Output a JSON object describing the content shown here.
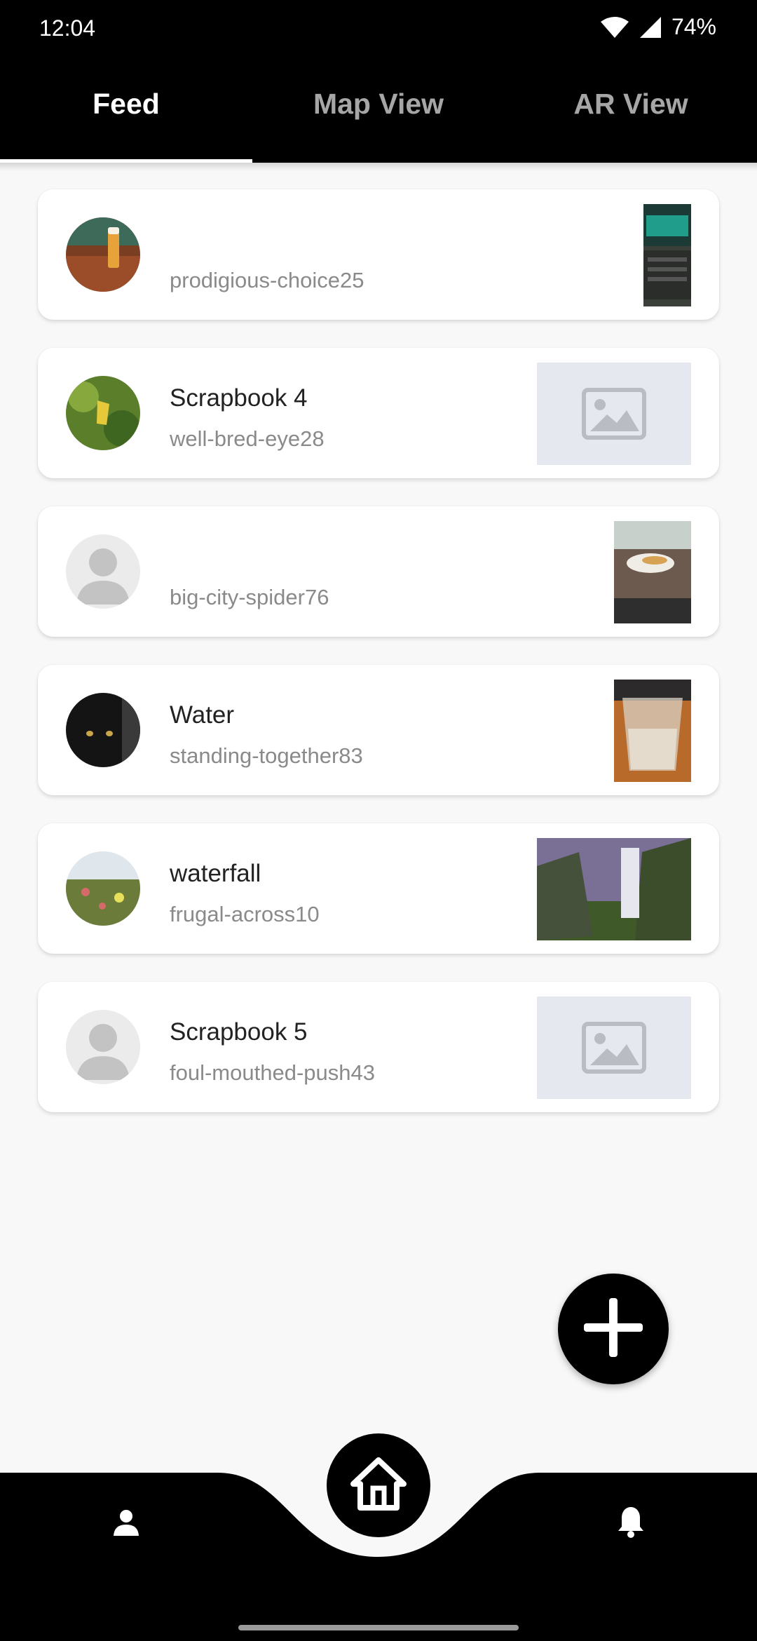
{
  "status_bar": {
    "time": "12:04",
    "battery": "74%"
  },
  "tabs": [
    {
      "label": "Feed",
      "active": true
    },
    {
      "label": "Map View",
      "active": false
    },
    {
      "label": "AR View",
      "active": false
    }
  ],
  "feed": [
    {
      "title": "",
      "user": "prodigious-choice25",
      "avatar": "beer-photo",
      "thumbnail": "laptop-photo"
    },
    {
      "title": "Scrapbook 4",
      "user": "well-bred-eye28",
      "avatar": "starfruit-photo",
      "thumbnail": "image-placeholder-icon"
    },
    {
      "title": "",
      "user": "big-city-spider76",
      "avatar": "default-person-icon",
      "thumbnail": "food-table-photo"
    },
    {
      "title": "Water",
      "user": "standing-together83",
      "avatar": "black-cat-photo",
      "thumbnail": "water-glass-photo"
    },
    {
      "title": "waterfall",
      "user": "frugal-across10",
      "avatar": "flower-field-photo",
      "thumbnail": "waterfall-photo"
    },
    {
      "title": "Scrapbook 5",
      "user": "foul-mouthed-push43",
      "avatar": "default-person-icon",
      "thumbnail": "image-placeholder-icon"
    }
  ],
  "icons": {
    "fab": "plus-icon",
    "nav_left": "person-icon",
    "nav_center": "home-icon",
    "nav_right": "bell-icon"
  },
  "colors": {
    "bar": "#000000",
    "background": "#f8f8f8",
    "inactive_tab": "#a6a6a6"
  }
}
